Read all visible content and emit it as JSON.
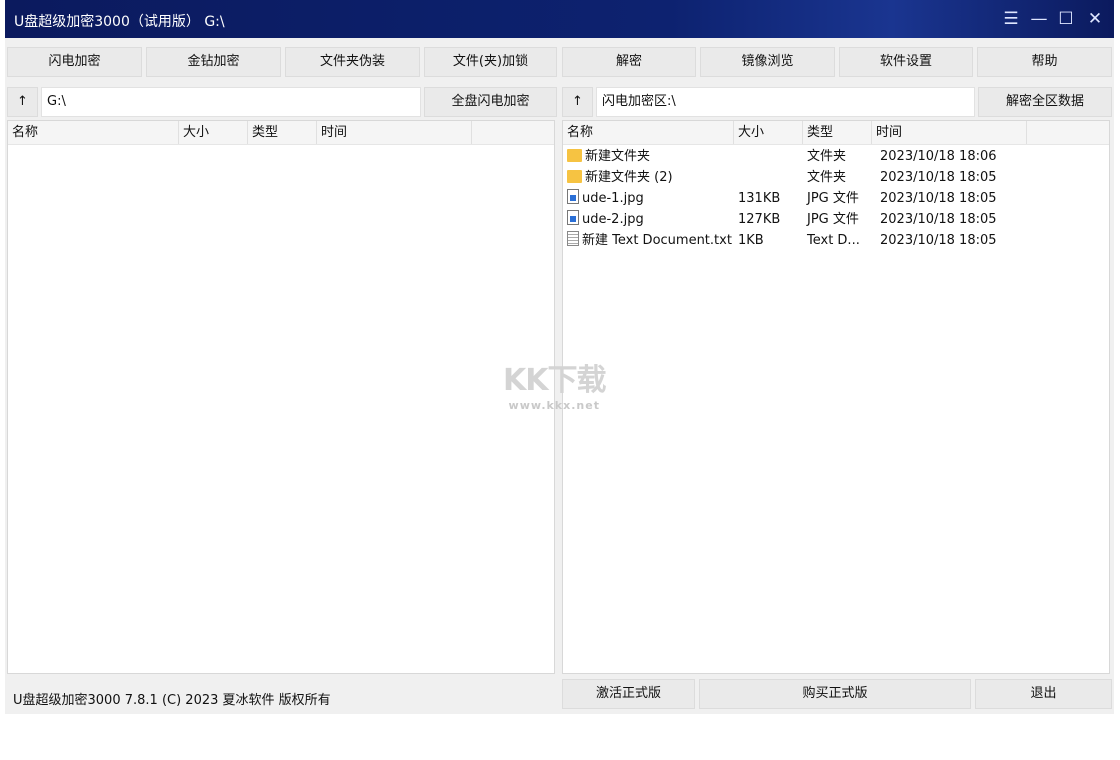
{
  "title": "U盘超级加密3000（试用版） G:\\",
  "toolbar": [
    "闪电加密",
    "金钻加密",
    "文件夹伪装",
    "文件(夹)加锁",
    "解密",
    "镜像浏览",
    "软件设置",
    "帮助"
  ],
  "left": {
    "up": "↑",
    "path": "G:\\",
    "action": "全盘闪电加密",
    "columns": [
      "名称",
      "大小",
      "类型",
      "时间"
    ]
  },
  "right": {
    "up": "↑",
    "path": "闪电加密区:\\",
    "action": "解密全区数据",
    "columns": [
      "名称",
      "大小",
      "类型",
      "时间"
    ],
    "rows": [
      {
        "icon": "folder",
        "name": "新建文件夹",
        "size": "",
        "type": "文件夹",
        "time": "2023/10/18 18:06"
      },
      {
        "icon": "folder",
        "name": "新建文件夹 (2)",
        "size": "",
        "type": "文件夹",
        "time": "2023/10/18 18:05"
      },
      {
        "icon": "image",
        "name": "ude-1.jpg",
        "size": "131KB",
        "type": "JPG 文件",
        "time": "2023/10/18 18:05"
      },
      {
        "icon": "image",
        "name": "ude-2.jpg",
        "size": "127KB",
        "type": "JPG 文件",
        "time": "2023/10/18 18:05"
      },
      {
        "icon": "text",
        "name": "新建 Text Document.txt",
        "size": "1KB",
        "type": "Text D...",
        "time": "2023/10/18 18:05"
      }
    ]
  },
  "footer": {
    "copyright": "U盘超级加密3000 7.8.1 (C) 2023 夏冰软件 版权所有",
    "activate": "激活正式版",
    "buy": "购买正式版",
    "exit": "退出"
  },
  "watermark": {
    "logo": "KK下载",
    "url": "www.kkx.net"
  },
  "window_controls": {
    "menu": "☰",
    "min": "—",
    "max": "☐",
    "close": "✕"
  }
}
